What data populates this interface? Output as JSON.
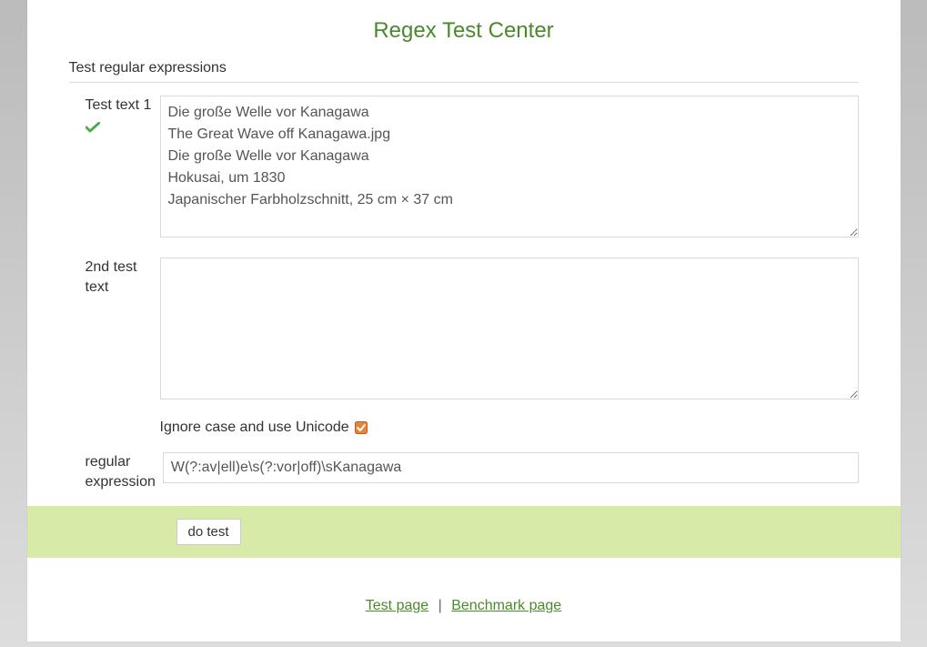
{
  "title": "Regex Test Center",
  "legend": "Test regular expressions",
  "fields": {
    "text1": {
      "label": "Test text 1",
      "value": "Die große Welle vor Kanagawa\nThe Great Wave off Kanagawa.jpg\nDie große Welle vor Kanagawa\nHokusai, um 1830\nJapanischer Farbholzschnitt, 25 cm × 37 cm",
      "valid": true
    },
    "text2": {
      "label": "2nd test text",
      "value": ""
    },
    "ignoreCase": {
      "label": "Ignore case and use Unicode",
      "checked": true
    },
    "regex": {
      "label": "regular expression",
      "value": "W(?:av|ell)e\\s(?:vor|off)\\sKanagawa"
    }
  },
  "buttons": {
    "doTest": "do test"
  },
  "footer": {
    "testPage": "Test page",
    "benchmarkPage": "Benchmark page",
    "separator": "|"
  }
}
